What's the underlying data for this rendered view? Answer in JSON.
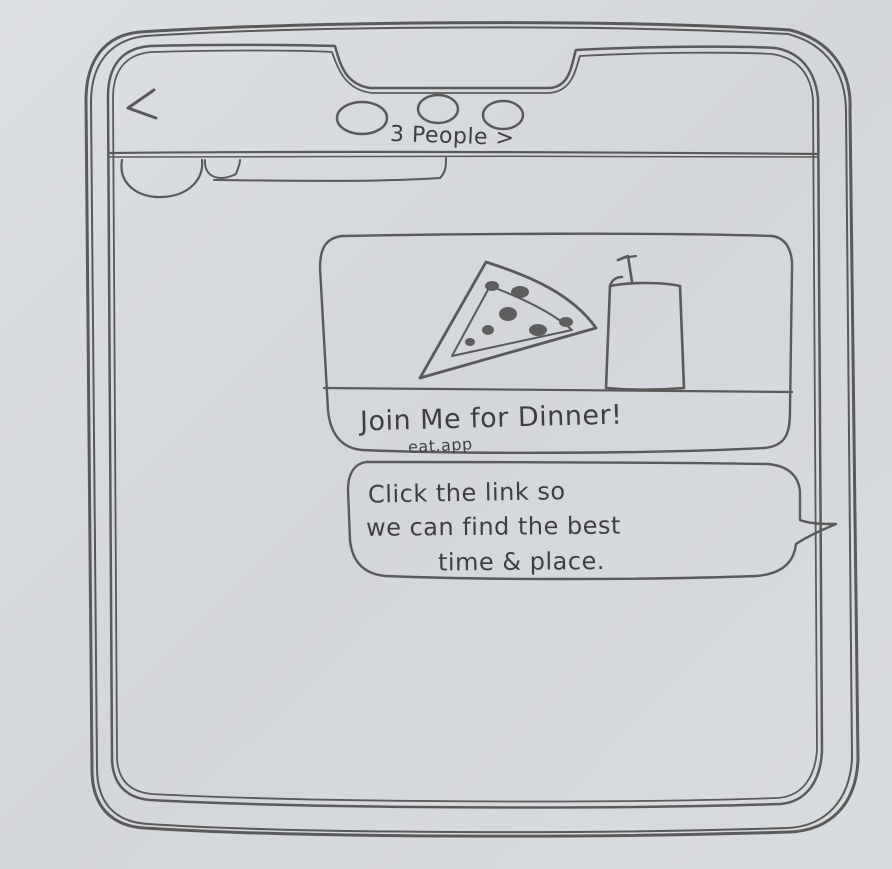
{
  "header": {
    "back_icon": "chevron-left-icon",
    "participants_link": "3 People >",
    "avatar_icon": "avatar-circle-icon"
  },
  "link_preview": {
    "image_icons": [
      "pizza-slice-icon",
      "drink-cup-icon"
    ],
    "title": "Join Me for Dinner!",
    "url": "eat.app"
  },
  "message": {
    "lines": [
      "Click the link so",
      "we can find the best",
      "time & place."
    ]
  },
  "colors": {
    "pencil": "#555555",
    "paper": "#d6d9dd"
  }
}
